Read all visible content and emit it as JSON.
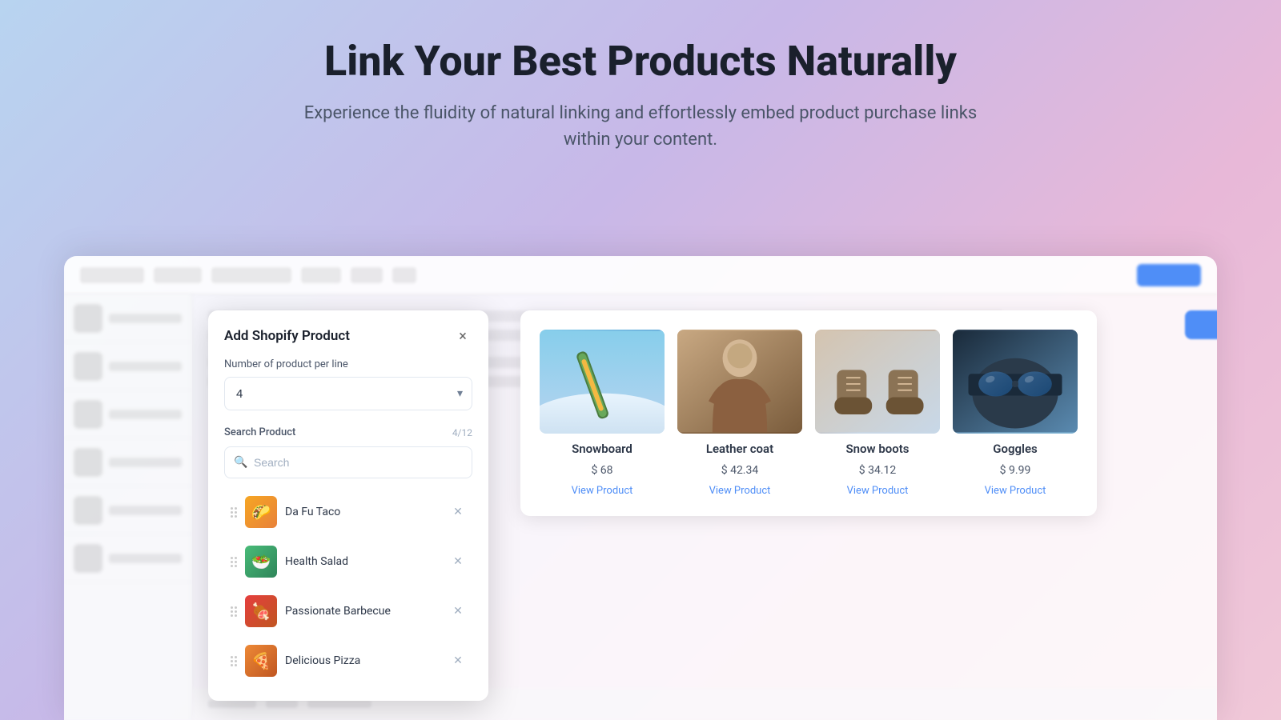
{
  "hero": {
    "title": "Link Your Best Products Naturally",
    "subtitle": "Experience the fluidity of natural linking and effortlessly embed product purchase links within your content."
  },
  "modal": {
    "title": "Add Shopify Product",
    "close_label": "×",
    "per_line_label": "Number of product per line",
    "per_line_value": "4",
    "search_product_label": "Search Product",
    "search_count": "4/12",
    "search_placeholder": "Search",
    "products": [
      {
        "name": "Da Fu Taco",
        "id": "taco"
      },
      {
        "name": "Health Salad",
        "id": "salad"
      },
      {
        "name": "Passionate Barbecue",
        "id": "bbq"
      },
      {
        "name": "Delicious Pizza",
        "id": "pizza"
      }
    ]
  },
  "product_cards": {
    "items": [
      {
        "name": "Snowboard",
        "price": "$ 68",
        "link": "View Product",
        "img_class": "img-snowboard",
        "emoji": "🏂"
      },
      {
        "name": "Leather coat",
        "price": "$ 42.34",
        "link": "View Product",
        "img_class": "img-leather-coat",
        "emoji": "🧥"
      },
      {
        "name": "Snow boots",
        "price": "$ 34.12",
        "link": "View Product",
        "img_class": "img-snow-boots",
        "emoji": "👢"
      },
      {
        "name": "Goggles",
        "price": "$ 9.99",
        "link": "View Product",
        "img_class": "img-goggles",
        "emoji": "🥽"
      }
    ]
  }
}
